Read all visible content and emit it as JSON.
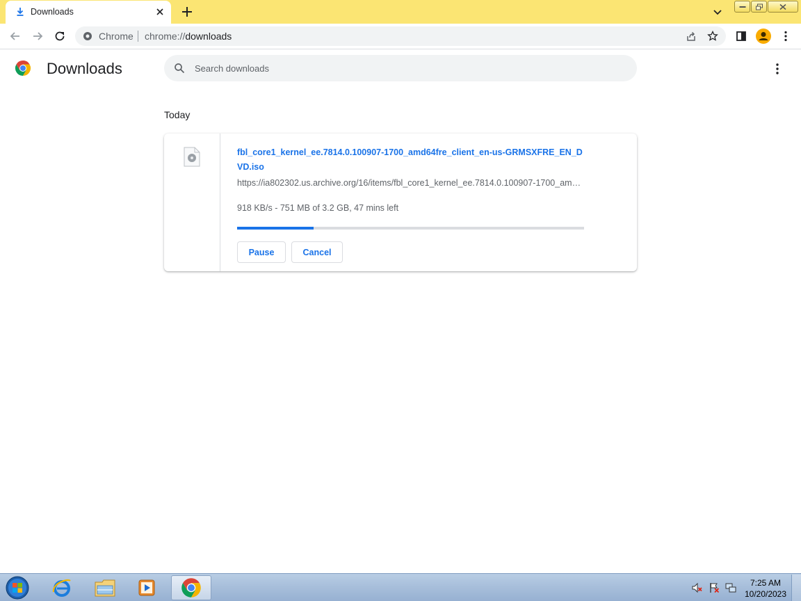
{
  "browser": {
    "tab": {
      "title": "Downloads",
      "icon": "download-icon"
    },
    "omnibox": {
      "site_chip": "Chrome",
      "url_scheme": "chrome://",
      "url_host": "downloads"
    },
    "colors": {
      "frame": "#fbe573",
      "accent": "#1a73e8",
      "avatar": "#f9ab00"
    }
  },
  "page": {
    "title": "Downloads",
    "search": {
      "placeholder": "Search downloads",
      "value": ""
    }
  },
  "downloads": {
    "section_date": "Today",
    "items": [
      {
        "file_name": "fbl_core1_kernel_ee.7814.0.100907-1700_amd64fre_client_en-us-GRMSXFRE_EN_DVD.iso",
        "url": "https://ia802302.us.archive.org/16/items/fbl_core1_kernel_ee.7814.0.100907-1700_amd64fre_client_en-us-GRMSXFRE_EN_DVD.iso",
        "status": "918 KB/s - 751 MB of 3.2 GB, 47 mins left",
        "progress_percent": 22,
        "actions": {
          "pause": "Pause",
          "cancel": "Cancel"
        }
      }
    ]
  },
  "taskbar": {
    "clock_time": "7:25 AM",
    "clock_date": "10/20/2023",
    "apps": [
      "internet-explorer-icon",
      "file-explorer-icon",
      "media-player-icon",
      "chrome-icon"
    ]
  }
}
